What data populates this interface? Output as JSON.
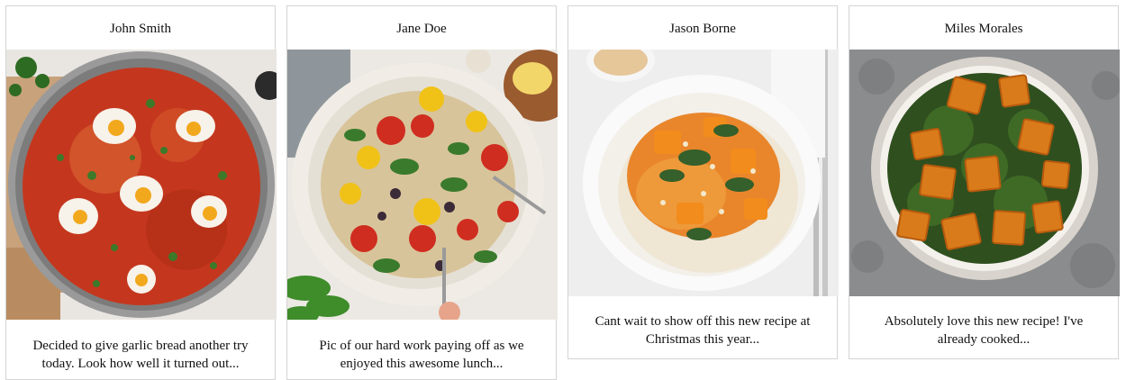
{
  "posts": [
    {
      "author": "John Smith",
      "photo": "shakshuka-pan-photo",
      "caption": "Decided to give garlic bread another try today. Look how well it turned out..."
    },
    {
      "author": "Jane Doe",
      "photo": "pasta-salad-bowl-photo",
      "caption": "Pic of our hard work paying off as we enjoyed this awesome lunch..."
    },
    {
      "author": "Jason Borne",
      "photo": "curry-rice-plate-photo",
      "caption": "Cant wait to show off this new recipe at Christmas this year..."
    },
    {
      "author": "Miles Morales",
      "photo": "saag-paneer-bowl-photo",
      "caption": "Absolutely love this new recipe! I've already cooked..."
    }
  ]
}
